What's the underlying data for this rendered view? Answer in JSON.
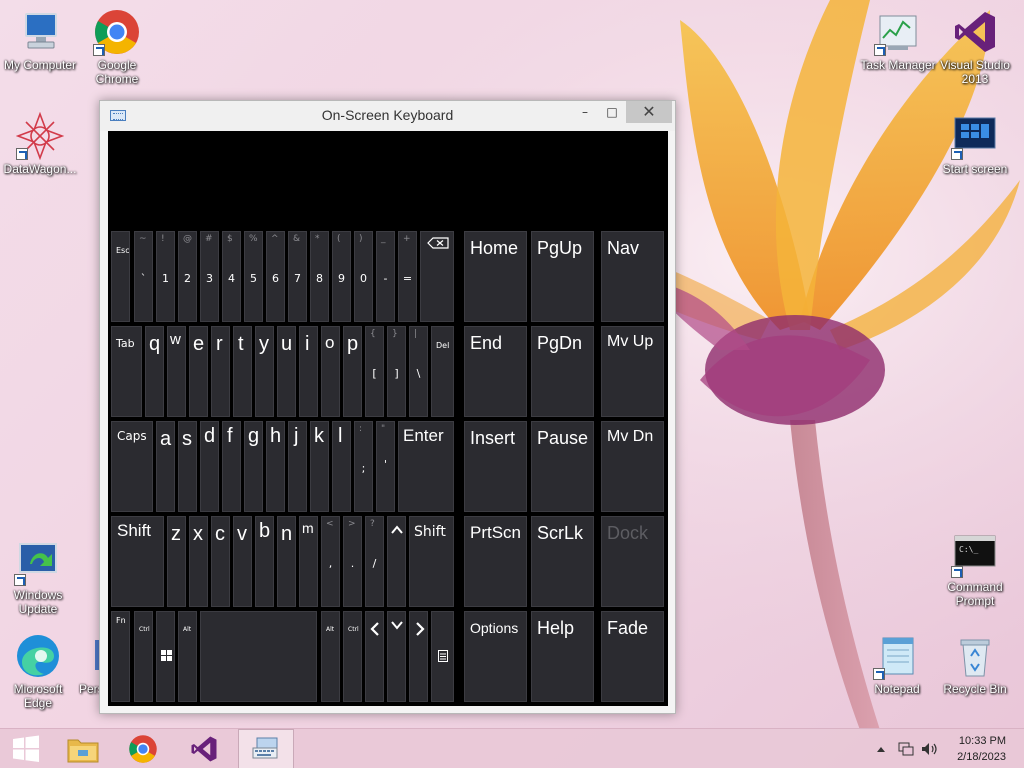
{
  "desktop": {
    "icons": [
      {
        "label": "My Computer",
        "icon": "computer-icon"
      },
      {
        "label": "Google Chrome",
        "icon": "chrome-icon"
      },
      {
        "label": "DataWagon...",
        "icon": "datawagon-icon"
      },
      {
        "label": "Task Manager",
        "icon": "task-manager-icon"
      },
      {
        "label": "Visual Studio 2013",
        "icon": "visual-studio-icon"
      },
      {
        "label": "Start screen",
        "icon": "start-screen-icon"
      },
      {
        "label": "Windows Update",
        "icon": "windows-update-icon"
      },
      {
        "label": "Command Prompt",
        "icon": "command-prompt-icon"
      },
      {
        "label": "Microsoft Edge",
        "icon": "edge-icon"
      },
      {
        "label": "Pers",
        "icon": "personalize-icon"
      },
      {
        "label": "Notepad",
        "icon": "notepad-icon"
      },
      {
        "label": "Recycle Bin",
        "icon": "recycle-bin-icon"
      }
    ]
  },
  "osk": {
    "title": "On-Screen Keyboard",
    "minimize": "–",
    "maximize": "□",
    "close": "✕",
    "row1": [
      {
        "sub": "Esc",
        "main": ""
      },
      {
        "sub": "~",
        "main": "`"
      },
      {
        "sub": "!",
        "main": "1"
      },
      {
        "sub": "@",
        "main": "2"
      },
      {
        "sub": "#",
        "main": "3"
      },
      {
        "sub": "$",
        "main": "4"
      },
      {
        "sub": "%",
        "main": "5"
      },
      {
        "sub": "^",
        "main": "6"
      },
      {
        "sub": "&",
        "main": "7"
      },
      {
        "sub": "*",
        "main": "8"
      },
      {
        "sub": "(",
        "main": "9"
      },
      {
        "sub": ")",
        "main": "0"
      },
      {
        "sub": "_",
        "main": "-"
      },
      {
        "sub": "+",
        "main": "="
      }
    ],
    "row2_letters": [
      "q",
      "w",
      "e",
      "r",
      "t",
      "y",
      "u",
      "i",
      "o",
      "p"
    ],
    "row2_extra": [
      {
        "sub": "{",
        "main": "["
      },
      {
        "sub": "}",
        "main": "]"
      },
      {
        "sub": "|",
        "main": "\\"
      }
    ],
    "row3_letters": [
      "a",
      "s",
      "d",
      "f",
      "g",
      "h",
      "j",
      "k",
      "l"
    ],
    "row3_extra": [
      {
        "sub": ":",
        "main": ";"
      },
      {
        "sub": "\"",
        "main": "'"
      }
    ],
    "row4_letters": [
      "z",
      "x",
      "c",
      "v",
      "b",
      "n",
      "m"
    ],
    "row4_extra": [
      {
        "sub": "<",
        "main": ","
      },
      {
        "sub": ">",
        "main": "."
      },
      {
        "sub": "?",
        "main": "/"
      }
    ],
    "labels": {
      "tab": "Tab",
      "del": "Del",
      "caps": "Caps",
      "enter": "Enter",
      "shift_left": "Shift",
      "shift_right": "Shift",
      "fn": "Fn",
      "ctrl_left": "Ctrl",
      "alt_left": "Alt",
      "alt_right": "Alt",
      "ctrl_right": "Ctrl"
    },
    "nav": {
      "home": "Home",
      "pgup": "PgUp",
      "nav": "Nav",
      "end": "End",
      "pgdn": "PgDn",
      "mvup": "Mv Up",
      "insert": "Insert",
      "pause": "Pause",
      "mvdn": "Mv Dn",
      "prtscn": "PrtScn",
      "scrlk": "ScrLk",
      "dock": "Dock",
      "options": "Options",
      "help": "Help",
      "fade": "Fade"
    }
  },
  "taskbar": {
    "time": "10:33 PM",
    "date": "2/18/2023",
    "items": [
      "start-button",
      "file-explorer-icon",
      "chrome-icon",
      "visual-studio-icon",
      "osk-icon"
    ]
  }
}
